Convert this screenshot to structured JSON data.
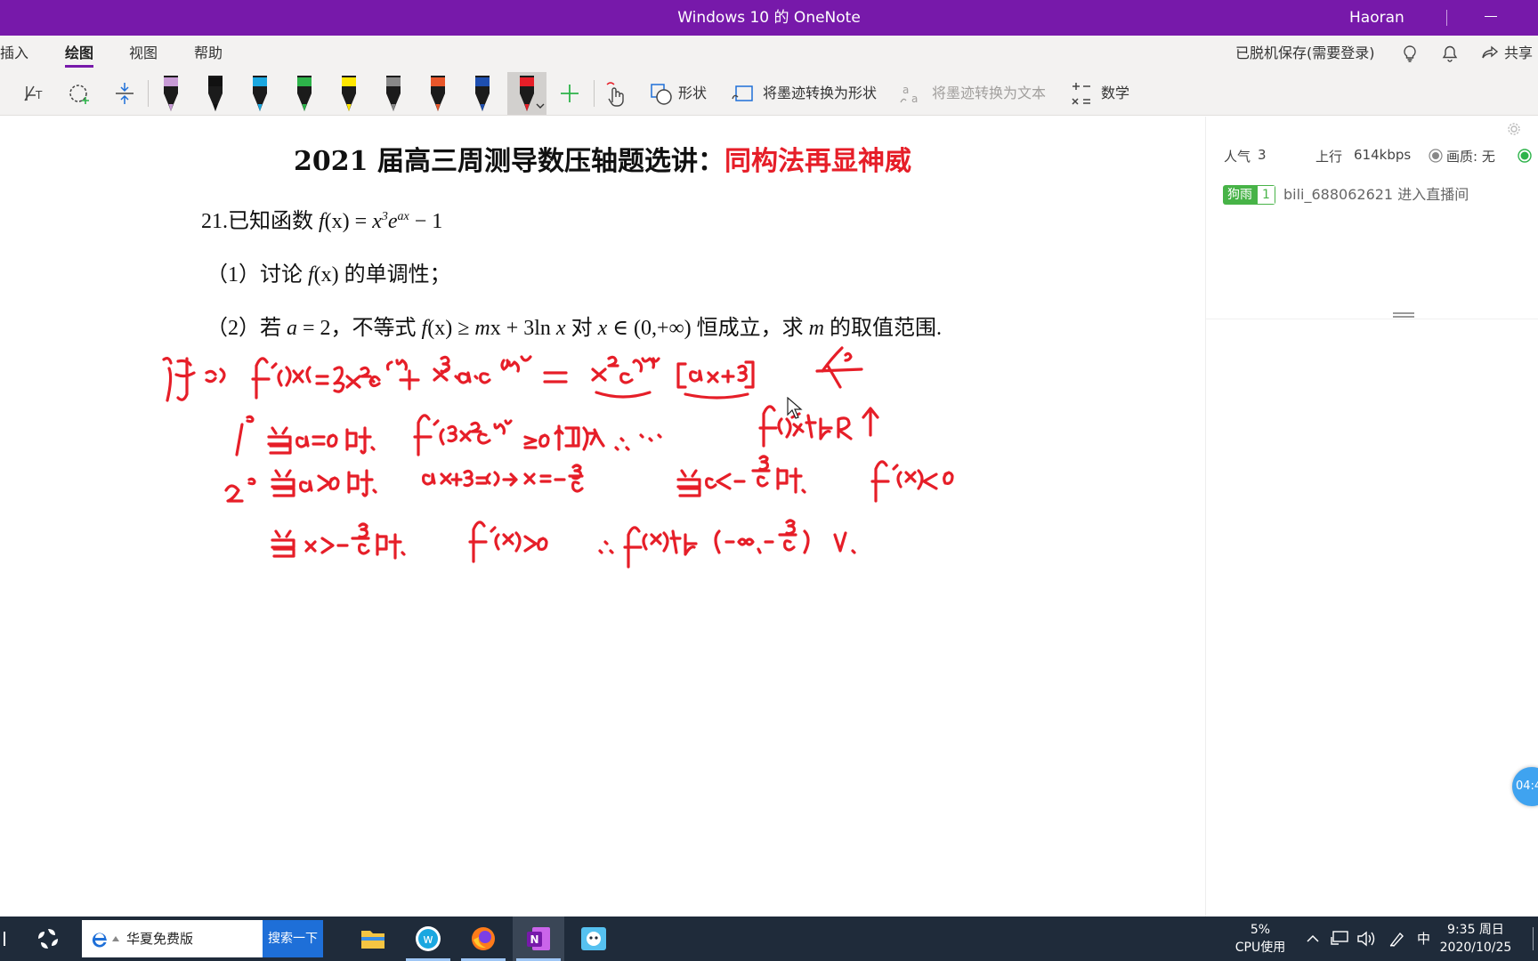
{
  "window": {
    "title": "Windows 10 的 OneNote",
    "user": "Haoran"
  },
  "menu": {
    "tabs": [
      {
        "label": "插入"
      },
      {
        "label": "绘图"
      },
      {
        "label": "视图"
      },
      {
        "label": "帮助"
      }
    ],
    "save_status": "已脱机保存(需要登录)",
    "share_label": "共享"
  },
  "ribbon": {
    "shapes_label": "形状",
    "ink_to_shape_label": "将墨迹转换为形状",
    "ink_to_text_label": "将墨迹转换为文本",
    "math_label": "数学",
    "pens": [
      {
        "color": "#c89bd6"
      },
      {
        "color": "#111111"
      },
      {
        "color": "#1aa7e0"
      },
      {
        "color": "#2db34a"
      },
      {
        "color": "#ffe600"
      },
      {
        "color": "#888888"
      },
      {
        "color": "#e8562a"
      },
      {
        "color": "#1e4fb0"
      },
      {
        "color": "#e61e28"
      }
    ],
    "add_pen_color": "#2db34a"
  },
  "document": {
    "title_main": "2021 届高三周测导数压轴题选讲：",
    "title_accent": "同构法再显神威",
    "accent_color": "#e61e28",
    "question": {
      "prefix": "21.已知函数 ",
      "func": "f",
      "arg": "(x) = ",
      "x": "x",
      "x_exp": "3",
      "e": "e",
      "e_exp": "ax",
      "tail": " − 1"
    },
    "part1": {
      "pre": "（1）讨论 ",
      "func": "f",
      "arg": "(x)",
      "post": " 的单调性；"
    },
    "part2": {
      "pre": "（2）若 ",
      "a": "a",
      "eq": " = 2，不等式 ",
      "func": "f",
      "arg": "(x) ≥ ",
      "m": "m",
      "mid": "x + 3ln ",
      "x1": "x",
      "in": " 对 ",
      "x2": "x",
      "range": " ∈ (0,+∞) 恒成立，求 ",
      "m2": "m",
      "end": " 的取值范围."
    },
    "ink_color": "#e61e28"
  },
  "live_panel": {
    "popularity_label": "人气",
    "popularity_value": "3",
    "upload_label": "上行",
    "upload_value": "614kbps",
    "quality_label": "画质: 无",
    "badge_name": "狗雨",
    "badge_level": "1",
    "enter_message": "bili_688062621 进入直播间",
    "timer": "04:4"
  },
  "taskbar": {
    "browser_label": "华夏免费版",
    "search_button": "搜索一下",
    "cpu_percent": "5%",
    "cpu_label": "CPU使用",
    "ime": "中",
    "time": "9:35 周日",
    "date": "2020/10/25"
  }
}
